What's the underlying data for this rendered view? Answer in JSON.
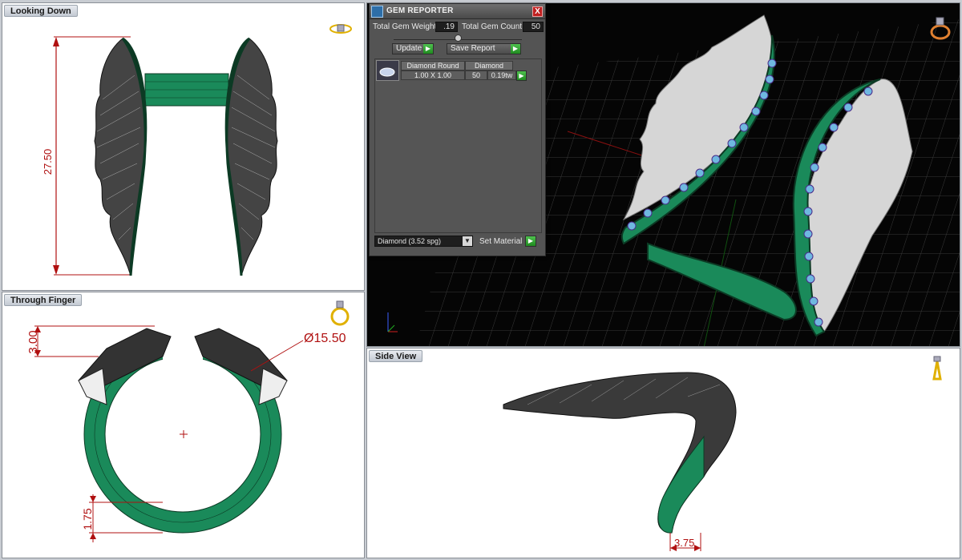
{
  "viewports": {
    "top_left": {
      "title": "Looking Down",
      "dimension": "27.50"
    },
    "bottom_left": {
      "title": "Through Finger",
      "dim_top": "3.00",
      "dim_diameter": "Ø15.50",
      "dim_bottom": "1.75"
    },
    "bottom_right": {
      "title": "Side View",
      "dim_bottom": "3.75"
    }
  },
  "gem_reporter": {
    "title": "GEM REPORTER",
    "close_label": "X",
    "total_weight_label": "Total Gem Weight",
    "total_weight_value": ".19",
    "total_count_label": "Total Gem Count",
    "total_count_value": "50",
    "update_label": "Update",
    "save_report_label": "Save Report",
    "table": {
      "headers": [
        "Diamond Round",
        "Diamond"
      ],
      "row": {
        "size": "1.00 X 1.00",
        "count": "50",
        "weight": "0.19tw"
      }
    },
    "material_value": "Diamond    (3.52 spg)",
    "set_material_label": "Set Material"
  },
  "colors": {
    "metal": "#1a8a5a",
    "dimension": "#b01010",
    "gem": "#6fb8e0",
    "accent_go": "#2fa22f"
  }
}
